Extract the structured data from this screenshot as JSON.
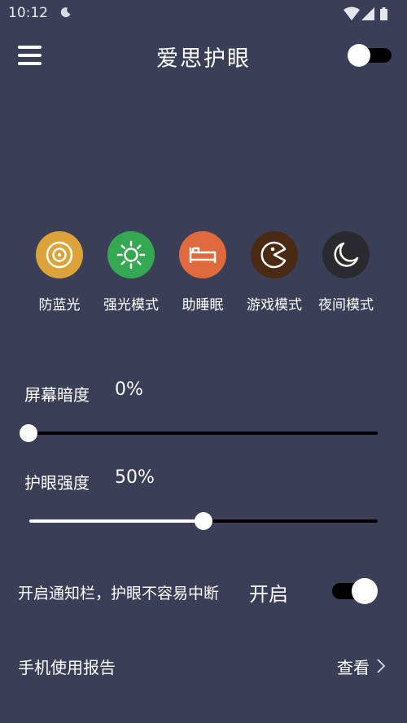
{
  "status_bar": {
    "time": "10:12"
  },
  "app_bar": {
    "title": "爱思护眼",
    "master_toggle_on": false
  },
  "modes": [
    {
      "label": "防蓝光",
      "icon": "target-icon",
      "color": "#dba33a"
    },
    {
      "label": "强光模式",
      "icon": "sun-icon",
      "color": "#35a852"
    },
    {
      "label": "助睡眠",
      "icon": "bed-icon",
      "color": "#df6a3e"
    },
    {
      "label": "游戏模式",
      "icon": "pacman-icon",
      "color": "#4a2a12"
    },
    {
      "label": "夜间模式",
      "icon": "moon-icon",
      "color": "#2a2a2f"
    }
  ],
  "screen_dim": {
    "label": "屏幕暗度",
    "value_text": "0%",
    "fraction": 0.0
  },
  "eye_strength": {
    "label": "护眼强度",
    "value_text": "50%",
    "fraction": 0.5
  },
  "notification": {
    "text": "开启通知栏，护眼不容易中断",
    "status": "开启",
    "toggle_on": true
  },
  "report": {
    "label": "手机使用报告",
    "action": "查看"
  },
  "colors": {
    "background": "#3a3e56",
    "track": "#000000",
    "thumb": "#ffffff"
  }
}
